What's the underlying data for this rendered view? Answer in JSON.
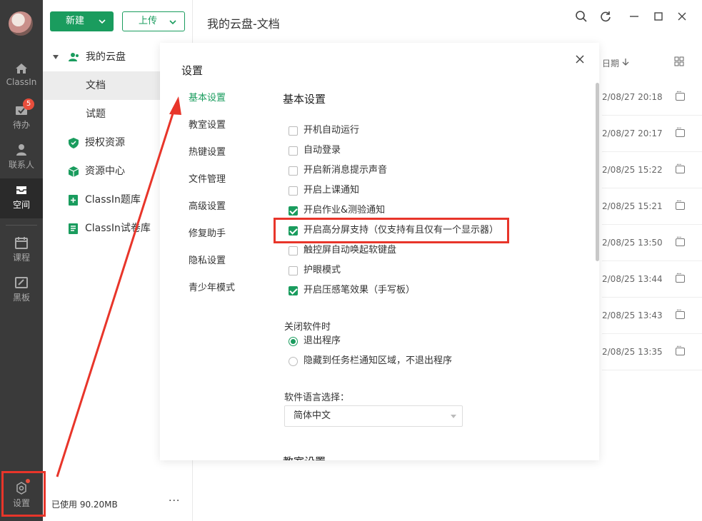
{
  "rail": {
    "items": [
      {
        "label": "ClassIn",
        "icon": "home-icon"
      },
      {
        "label": "待办",
        "icon": "todo-icon",
        "badge": "5"
      },
      {
        "label": "联系人",
        "icon": "contacts-icon"
      },
      {
        "label": "空间",
        "icon": "cloud-space-icon"
      },
      {
        "label": "课程",
        "icon": "calendar-icon"
      },
      {
        "label": "黑板",
        "icon": "blackboard-icon"
      }
    ],
    "settings_label": "设置"
  },
  "toolbar": {
    "new_label": "新建",
    "upload_label": "上传"
  },
  "tree": {
    "root": "我的云盘",
    "items": [
      {
        "label": "文档"
      },
      {
        "label": "试题"
      },
      {
        "label": "授权资源"
      },
      {
        "label": "资源中心"
      },
      {
        "label": "ClassIn题库"
      },
      {
        "label": "ClassIn试卷库"
      }
    ]
  },
  "usage": "已使用 90.20MB",
  "usage_more": "···",
  "breadcrumb": "我的云盘-文档",
  "list": {
    "date_header": "日期",
    "rows": [
      {
        "date": "2/08/27 20:18"
      },
      {
        "date": "2/08/27 20:17"
      },
      {
        "date": "2/08/25 15:22"
      },
      {
        "date": "2/08/25 15:21"
      },
      {
        "date": "2/08/25 13:50"
      },
      {
        "date": "2/08/25 13:44"
      },
      {
        "date": "2/08/25 13:43"
      },
      {
        "date": "2/08/25 13:35"
      }
    ]
  },
  "settings": {
    "title": "设置",
    "nav": [
      "基本设置",
      "教室设置",
      "热键设置",
      "文件管理",
      "高级设置",
      "修复助手",
      "隐私设置",
      "青少年模式"
    ],
    "active_nav": "基本设置",
    "section_title": "基本设置",
    "options": [
      {
        "label": "开机自动运行",
        "checked": false
      },
      {
        "label": "自动登录",
        "checked": false
      },
      {
        "label": "开启新消息提示声音",
        "checked": false
      },
      {
        "label": "开启上课通知",
        "checked": false
      },
      {
        "label": "开启作业&测验通知",
        "checked": true
      },
      {
        "label": "开启高分屏支持（仅支持有且仅有一个显示器）",
        "checked": true
      },
      {
        "label": "触控屏自动唤起软键盘",
        "checked": false
      },
      {
        "label": "护眼模式",
        "checked": false
      },
      {
        "label": "开启压感笔效果（手写板）",
        "checked": true
      }
    ],
    "close_heading": "关闭软件时",
    "close_options": [
      {
        "label": "退出程序",
        "selected": true
      },
      {
        "label": "隐藏到任务栏通知区域，不退出程序",
        "selected": false
      }
    ],
    "language_heading": "软件语言选择：",
    "language_value": "简体中文",
    "next_section": "教室设置"
  },
  "colors": {
    "accent": "#1a9c5e",
    "annotation": "#e8352a",
    "rail": "#3a3a3a"
  }
}
